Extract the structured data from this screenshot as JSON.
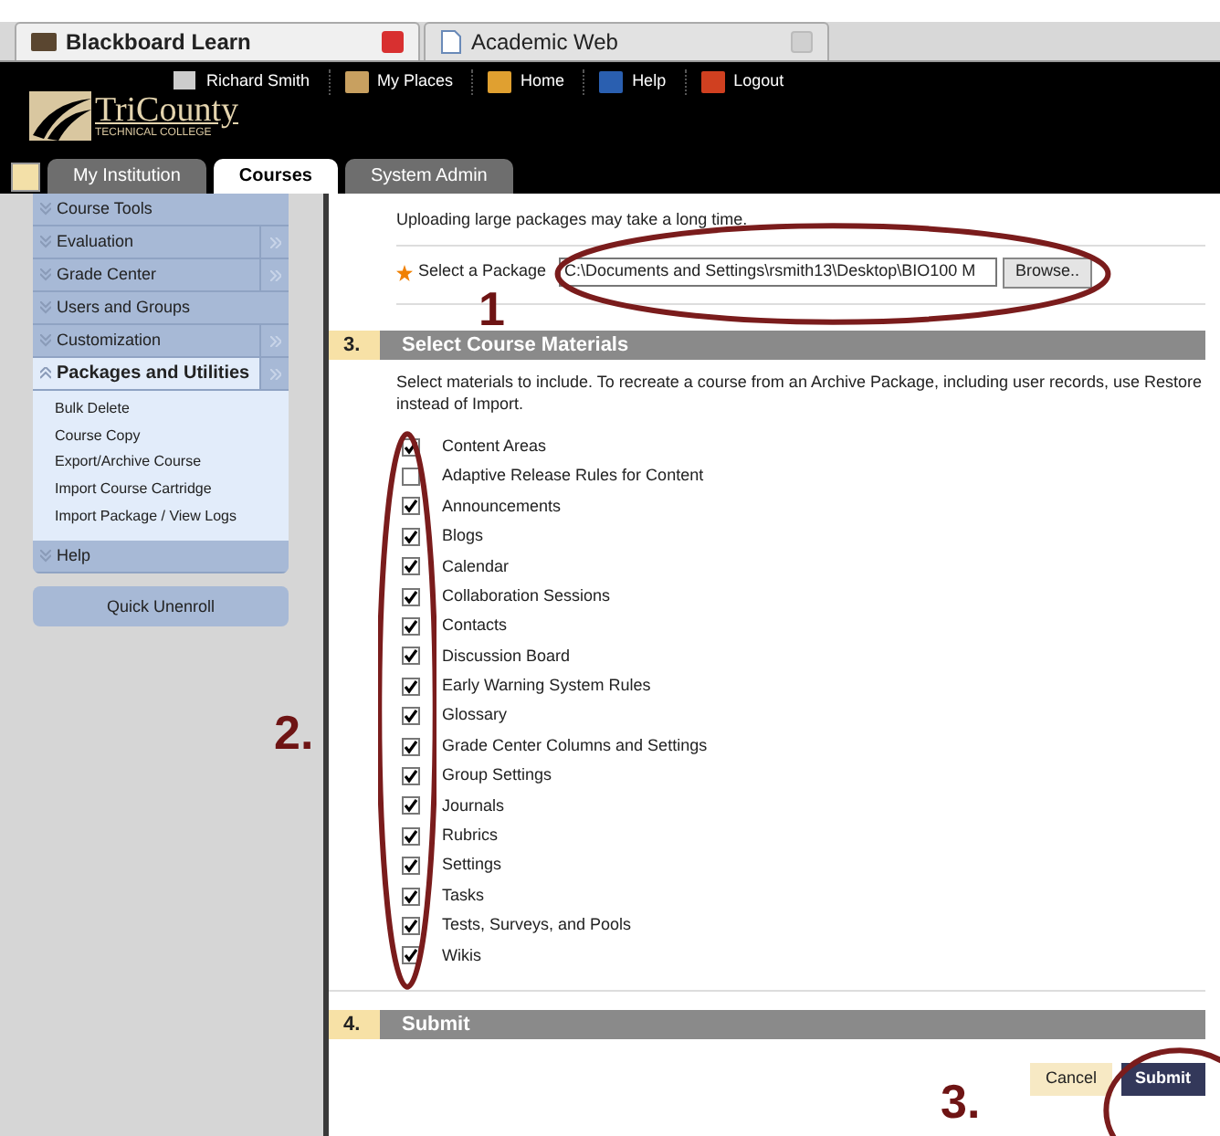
{
  "browser_tabs": [
    {
      "label": "Blackboard Learn",
      "selected": true
    },
    {
      "label": "Academic Web",
      "selected": false
    }
  ],
  "header": {
    "user": "Richard Smith",
    "links": [
      "My Places",
      "Home",
      "Help",
      "Logout"
    ],
    "logo": {
      "name": "TriCounty",
      "subtitle": "TECHNICAL COLLEGE"
    }
  },
  "nav_tabs": [
    {
      "label": "My Institution",
      "selected": false
    },
    {
      "label": "Courses",
      "selected": true
    },
    {
      "label": "System Admin",
      "selected": false
    }
  ],
  "sidebar": {
    "items": [
      {
        "label": "Course Tools",
        "expanded": false,
        "has_submenu": false
      },
      {
        "label": "Evaluation",
        "expanded": false,
        "has_submenu": true
      },
      {
        "label": "Grade Center",
        "expanded": false,
        "has_submenu": true
      },
      {
        "label": "Users and Groups",
        "expanded": false,
        "has_submenu": false
      },
      {
        "label": "Customization",
        "expanded": false,
        "has_submenu": true
      },
      {
        "label": "Packages and Utilities",
        "expanded": true,
        "has_submenu": true,
        "children": [
          "Bulk Delete",
          "Course Copy",
          "Export/Archive Course",
          "Import Course Cartridge",
          "Import Package / View Logs"
        ]
      },
      {
        "label": "Help",
        "expanded": false,
        "has_submenu": false
      }
    ],
    "quick_unenroll": "Quick Unenroll"
  },
  "upload_note": "Uploading large packages may take a long time.",
  "package_field": {
    "label": "Select a Package",
    "value": "C:\\Documents and Settings\\rsmith13\\Desktop\\BIO100 M",
    "browse": "Browse.."
  },
  "materials_section": {
    "number": "3.",
    "title": "Select Course Materials",
    "description": "Select materials to include. To recreate a course from an Archive Package, including user records, use Restore instead of Import.",
    "materials": [
      {
        "label": "Content Areas",
        "checked": true
      },
      {
        "label": "Adaptive Release Rules for Content",
        "checked": false
      },
      {
        "label": "Announcements",
        "checked": true
      },
      {
        "label": "Blogs",
        "checked": true
      },
      {
        "label": "Calendar",
        "checked": true
      },
      {
        "label": "Collaboration Sessions",
        "checked": true
      },
      {
        "label": "Contacts",
        "checked": true
      },
      {
        "label": "Discussion Board",
        "checked": true
      },
      {
        "label": "Early Warning System Rules",
        "checked": true
      },
      {
        "label": "Glossary",
        "checked": true
      },
      {
        "label": "Grade Center Columns and Settings",
        "checked": true
      },
      {
        "label": "Group Settings",
        "checked": true
      },
      {
        "label": "Journals",
        "checked": true
      },
      {
        "label": "Rubrics",
        "checked": true
      },
      {
        "label": "Settings",
        "checked": true
      },
      {
        "label": "Tasks",
        "checked": true
      },
      {
        "label": "Tests, Surveys, and Pools",
        "checked": true
      },
      {
        "label": "Wikis",
        "checked": true
      }
    ]
  },
  "submit_section": {
    "number": "4.",
    "title": "Submit",
    "cancel": "Cancel",
    "submit": "Submit"
  },
  "annotations": [
    "1",
    "2.",
    "3."
  ]
}
